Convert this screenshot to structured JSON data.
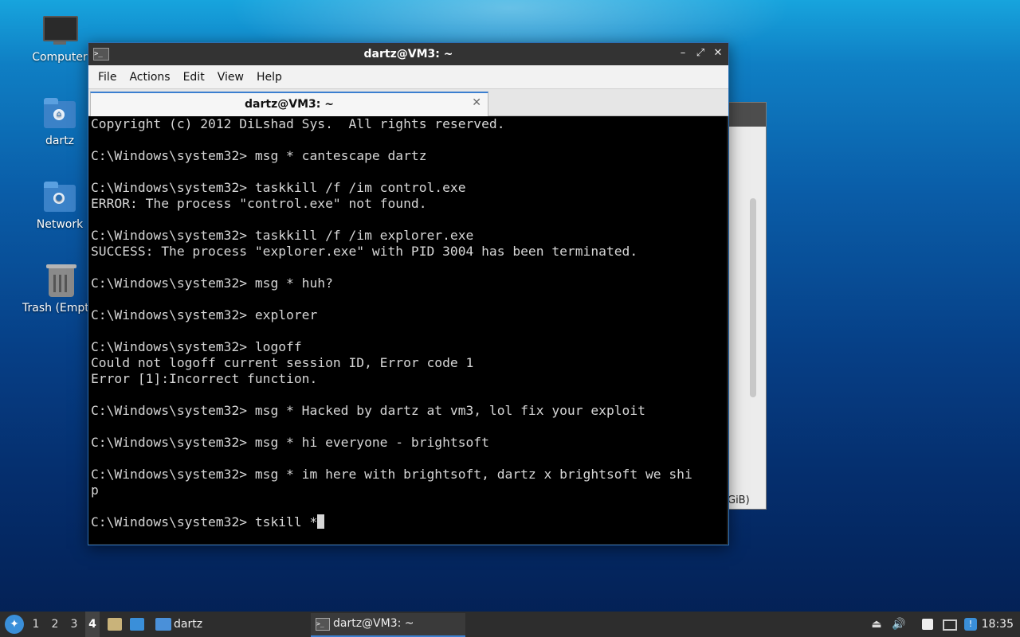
{
  "desktop": {
    "icons": [
      {
        "label": "Computer"
      },
      {
        "label": "dartz"
      },
      {
        "label": "Network"
      },
      {
        "label": "Trash (Empt"
      }
    ]
  },
  "background_window": {
    "partial_text": "GiB)"
  },
  "terminal_window": {
    "title": "dartz@VM3: ~",
    "controls": {
      "minimize": "–",
      "maximize": "⤢",
      "close": "✕"
    },
    "menu": [
      "File",
      "Actions",
      "Edit",
      "View",
      "Help"
    ],
    "tab": {
      "label": "dartz@VM3: ~",
      "close": "✕"
    },
    "lines": [
      "Copyright (c) 2012 DiLshad Sys.  All rights reserved.",
      "",
      "C:\\Windows\\system32> msg * cantescape dartz",
      "",
      "C:\\Windows\\system32> taskkill /f /im control.exe",
      "ERROR: The process \"control.exe\" not found.",
      "",
      "C:\\Windows\\system32> taskkill /f /im explorer.exe",
      "SUCCESS: The process \"explorer.exe\" with PID 3004 has been terminated.",
      "",
      "C:\\Windows\\system32> msg * huh?",
      "",
      "C:\\Windows\\system32> explorer",
      "",
      "C:\\Windows\\system32> logoff",
      "Could not logoff current session ID, Error code 1",
      "Error [1]:Incorrect function.",
      "",
      "C:\\Windows\\system32> msg * Hacked by dartz at vm3, lol fix your exploit",
      "",
      "C:\\Windows\\system32> msg * hi everyone - brightsoft",
      "",
      "C:\\Windows\\system32> msg * im here with brightsoft, dartz x brightsoft we shi",
      "p",
      ""
    ],
    "prompt_line": "C:\\Windows\\system32> tskill *"
  },
  "taskbar": {
    "workspaces": [
      "1",
      "2",
      "3",
      "4"
    ],
    "active_workspace": "4",
    "folder_label": "dartz",
    "task_label": "dartz@VM3: ~",
    "clock": "18:35"
  },
  "colors": {
    "accent": "#3b7fd0",
    "terminal_bg": "#000000",
    "terminal_fg": "#d6d6d6",
    "taskbar_bg": "#2d2d2d"
  }
}
